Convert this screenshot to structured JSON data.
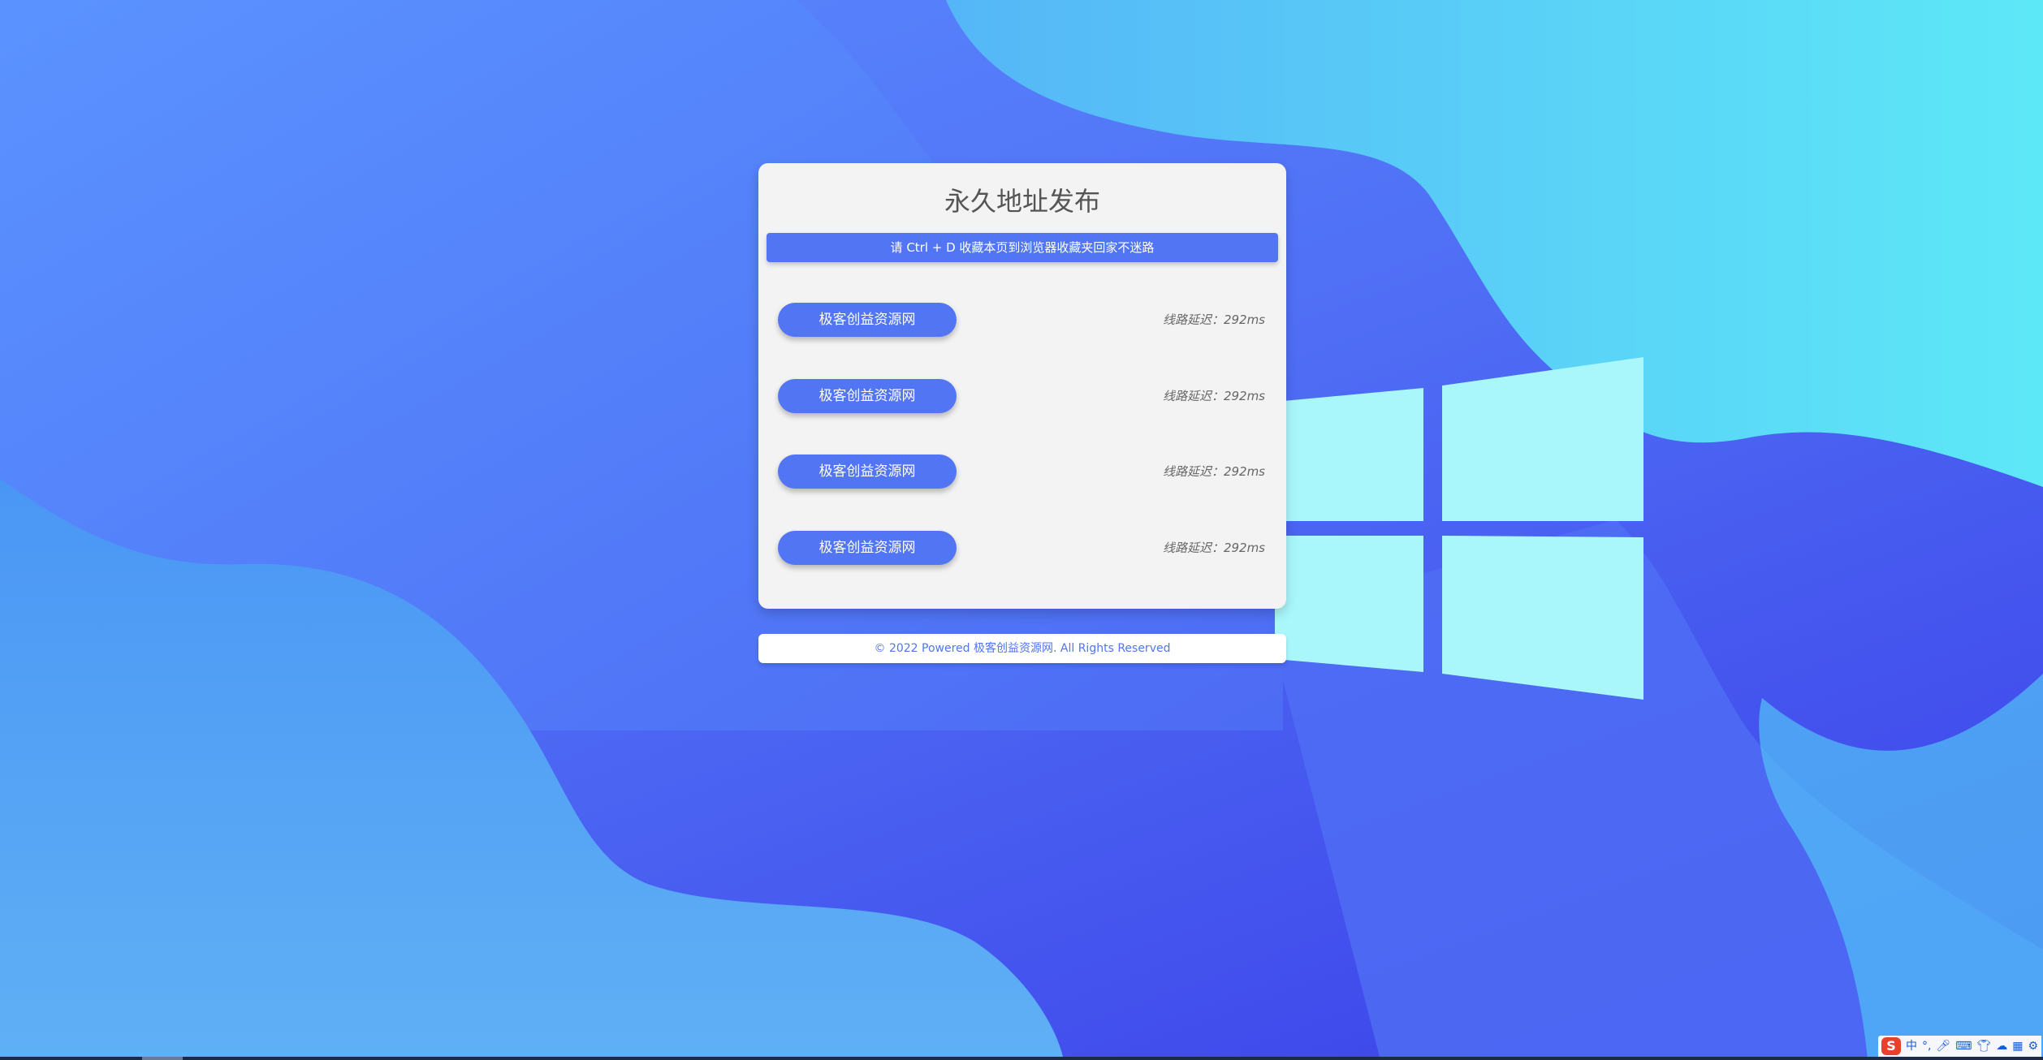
{
  "title": "永久地址发布",
  "notice": "请 Ctrl + D 收藏本页到浏览器收藏夹回家不迷路",
  "lines": [
    {
      "label": "极客创益资源网",
      "latency": "线路延迟：292ms"
    },
    {
      "label": "极客创益资源网",
      "latency": "线路延迟：292ms"
    },
    {
      "label": "极客创益资源网",
      "latency": "线路延迟：292ms"
    },
    {
      "label": "极客创益资源网",
      "latency": "线路延迟：292ms"
    }
  ],
  "footer": "© 2022 Powered 极客创益资源网. All Rights Reserved",
  "tray": {
    "ime": "S",
    "lang": "中",
    "icons": [
      "punctuation-icon",
      "microphone-icon",
      "keyboard-icon",
      "skin-icon",
      "cloud-icon",
      "grid-icon",
      "settings-icon"
    ]
  },
  "colors": {
    "accent": "#5175f3",
    "card": "#f3f3f3",
    "logo": "#a9f7fb"
  }
}
